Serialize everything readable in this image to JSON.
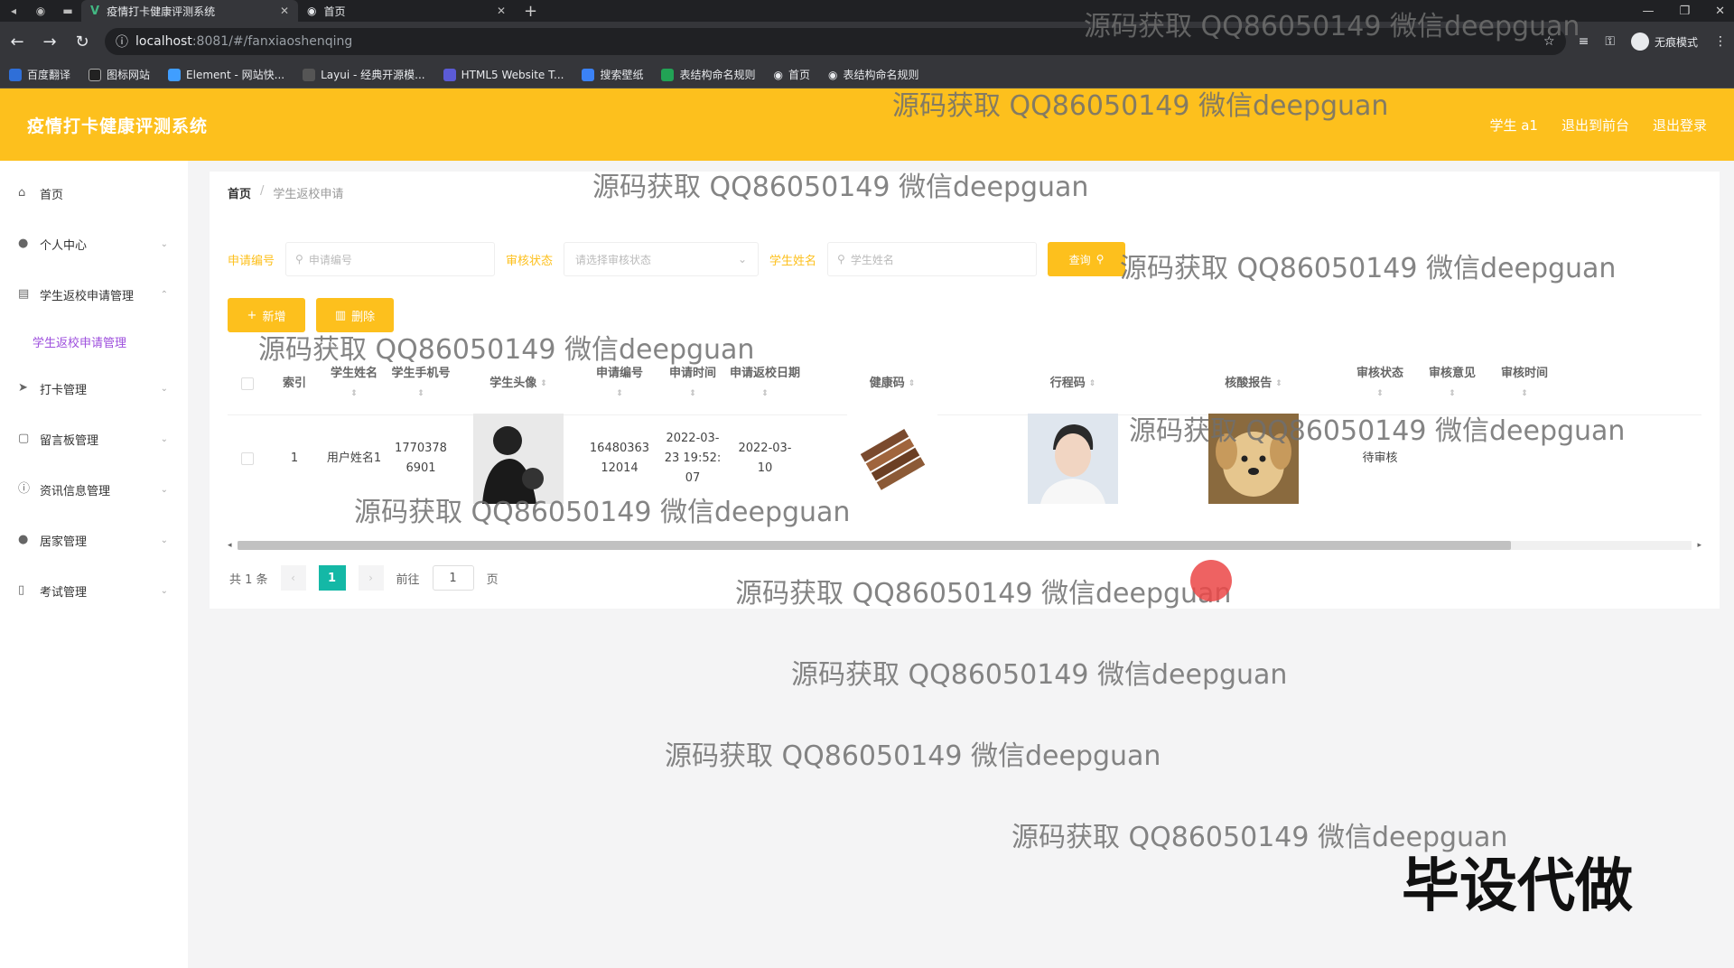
{
  "browser": {
    "tabs": [
      {
        "title": "疫情打卡健康评测系统",
        "active": true
      },
      {
        "title": "首页",
        "active": false
      }
    ],
    "url_host": "localhost",
    "url_path": ":8081/#/fanxiaoshenqing",
    "incognito_label": "无痕模式",
    "bookmarks": [
      "百度翻译",
      "图标网站",
      "Element - 网站快...",
      "Layui - 经典开源模...",
      "HTML5 Website T...",
      "搜索壁纸",
      "表结构命名规则",
      "首页",
      "表结构命名规则"
    ]
  },
  "header": {
    "title": "疫情打卡健康评测系统",
    "user": "学生 a1",
    "back_front": "退出到前台",
    "logout": "退出登录"
  },
  "sidebar": {
    "items": [
      {
        "label": "首页",
        "icon": "home-icon"
      },
      {
        "label": "个人中心",
        "icon": "user-icon"
      },
      {
        "label": "学生返校申请管理",
        "icon": "clipboard-icon"
      },
      {
        "label": "打卡管理",
        "icon": "send-icon"
      },
      {
        "label": "留言板管理",
        "icon": "message-icon"
      },
      {
        "label": "资讯信息管理",
        "icon": "info-icon"
      },
      {
        "label": "居家管理",
        "icon": "person-icon"
      },
      {
        "label": "考试管理",
        "icon": "exam-icon"
      }
    ],
    "sub_active": "学生返校申请管理"
  },
  "breadcrumb": {
    "home": "首页",
    "sep": "/",
    "current": "学生返校申请"
  },
  "search": {
    "label1": "申请编号",
    "placeholder1": "申请编号",
    "label2": "审核状态",
    "placeholder2": "请选择审核状态",
    "label3": "学生姓名",
    "placeholder3": "学生姓名",
    "query": "查询"
  },
  "actions": {
    "add": "新增",
    "delete": "删除"
  },
  "table": {
    "headers": [
      "索引",
      "学生姓名",
      "学生手机号",
      "学生头像",
      "申请编号",
      "申请时间",
      "申请返校日期",
      "健康码",
      "行程码",
      "核酸报告",
      "审核状态",
      "审核意见",
      "审核时间"
    ],
    "rows": [
      {
        "index": "1",
        "name": "用户姓名1",
        "phone": "17703786901",
        "apply_no": "1648036312014",
        "apply_time": "2022-03-23 19:52:07",
        "return_date": "2022-03-10",
        "status": "待审核"
      }
    ]
  },
  "pager": {
    "total": "共 1 条",
    "page": "1",
    "goto": "前往",
    "goto_value": "1",
    "page_unit": "页"
  },
  "watermark": {
    "text": "源码获取 QQ86050149 微信deepguan",
    "big": "毕设代做"
  },
  "colors": {
    "accent": "#fdc01d",
    "pager_active": "#14b8a6",
    "submenu": "#9d4edd"
  }
}
